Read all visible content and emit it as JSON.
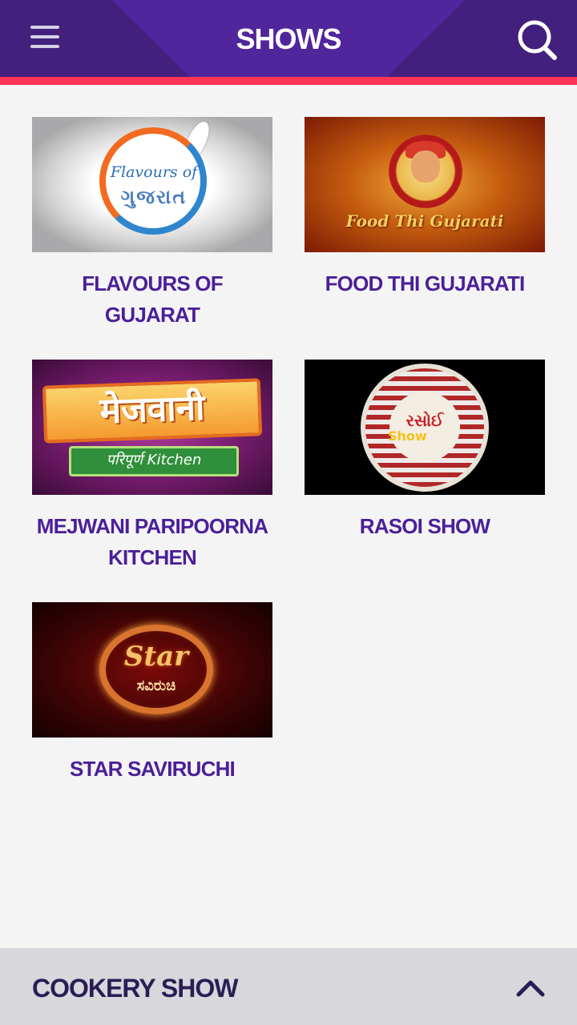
{
  "header": {
    "title": "SHOWS",
    "menu_icon": "hamburger-menu-icon",
    "search_icon": "search-icon",
    "colors": {
      "bar": "#43207e",
      "panel": "#51259c",
      "accent": "#ff3355"
    }
  },
  "shows": [
    {
      "title": "FLAVOURS OF GUJARAT",
      "thumb_text": [
        "Flavours of",
        "ગુજરાત"
      ]
    },
    {
      "title": "FOOD THI GUJARATI",
      "thumb_text": [
        "Food Thi Gujarati"
      ]
    },
    {
      "title": "MEJWANI PARIPOORNA KITCHEN",
      "thumb_text": [
        "मेजवानी",
        "परिपूर्ण Kitchen"
      ]
    },
    {
      "title": "RASOI SHOW",
      "thumb_text": [
        "રસોઈ",
        "Show"
      ]
    },
    {
      "title": "STAR SAVIRUCHI",
      "thumb_text": [
        "Star",
        "ಸವಿರುಚಿ"
      ]
    }
  ],
  "title_color": "#4b1f98",
  "footer": {
    "label": "COOKERY SHOW",
    "icon": "chevron-up-icon"
  }
}
